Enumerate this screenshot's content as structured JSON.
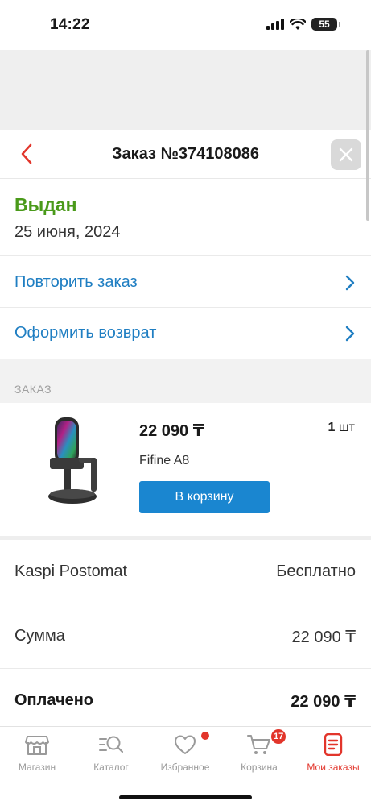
{
  "status_bar": {
    "time": "14:22",
    "battery": "55"
  },
  "header": {
    "title": "Заказ №374108086"
  },
  "order": {
    "status": "Выдан",
    "date": "25 июня, 2024",
    "status_color": "#4a9a1a"
  },
  "actions": [
    {
      "label": "Повторить заказ"
    },
    {
      "label": "Оформить возврат"
    }
  ],
  "section_label": "ЗАКАЗ",
  "product": {
    "price": "22 090 ₸",
    "qty_number": "1",
    "qty_unit": "шт",
    "name": "Fifine A8",
    "cart_button": "В корзину"
  },
  "summary": [
    {
      "key": "Kaspi Postomat",
      "value": "Бесплатно"
    },
    {
      "key": "Сумма",
      "value": "22 090 ₸"
    },
    {
      "key": "Оплачено",
      "value": "22 090 ₸"
    }
  ],
  "tabbar": {
    "tabs": [
      {
        "label": "Магазин",
        "icon": "store-icon"
      },
      {
        "label": "Каталог",
        "icon": "catalog-search-icon"
      },
      {
        "label": "Избранное",
        "icon": "heart-icon"
      },
      {
        "label": "Корзина",
        "icon": "cart-icon",
        "badge": "17"
      },
      {
        "label": "Мои заказы",
        "icon": "orders-icon",
        "active": true
      }
    ]
  },
  "colors": {
    "accent": "#1a86d0",
    "link": "#1f7ec2",
    "active_tab": "#e2352b"
  }
}
